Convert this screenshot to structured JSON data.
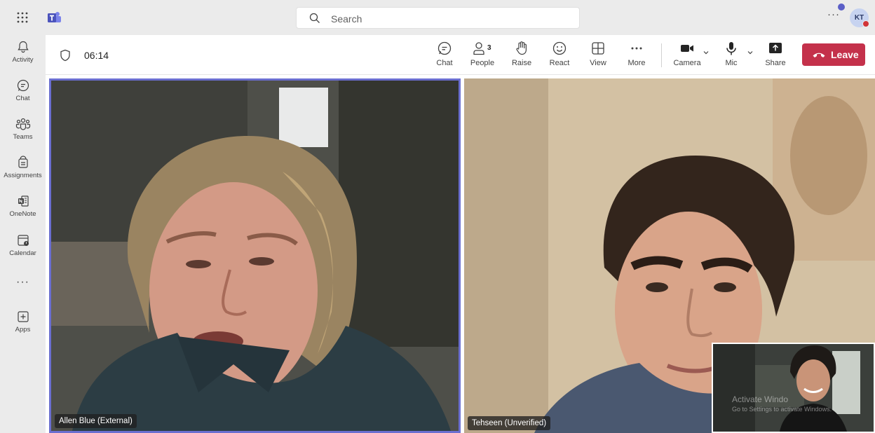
{
  "topbar": {
    "search_placeholder": "Search",
    "avatar_initials": "KT",
    "more_label": "···"
  },
  "rail": {
    "items": [
      {
        "label": "Activity",
        "icon": "bell-icon"
      },
      {
        "label": "Chat",
        "icon": "chat-icon"
      },
      {
        "label": "Teams",
        "icon": "teams-icon"
      },
      {
        "label": "Assignments",
        "icon": "assignments-icon"
      },
      {
        "label": "OneNote",
        "icon": "onenote-icon"
      },
      {
        "label": "Calendar",
        "icon": "calendar-icon"
      },
      {
        "label": "Apps",
        "icon": "apps-plus-icon"
      }
    ],
    "more_label": "···"
  },
  "meeting": {
    "timer": "06:14",
    "controls": [
      {
        "label": "Chat",
        "icon": "chat-icon"
      },
      {
        "label": "People",
        "icon": "people-icon",
        "count": "3"
      },
      {
        "label": "Raise",
        "icon": "raise-hand-icon"
      },
      {
        "label": "React",
        "icon": "smiley-icon"
      },
      {
        "label": "View",
        "icon": "grid-icon"
      },
      {
        "label": "More",
        "icon": "more-icon"
      },
      {
        "label": "Camera",
        "icon": "camera-icon"
      },
      {
        "label": "Mic",
        "icon": "mic-icon"
      },
      {
        "label": "Share",
        "icon": "share-icon"
      }
    ],
    "leave_label": "Leave",
    "leave_color": "#c4314b"
  },
  "participants": [
    {
      "name": "Allen Blue (External)"
    },
    {
      "name": "Tehseen (Unverified)"
    }
  ],
  "self_view": {
    "watermark_title": "Activate Windo",
    "watermark_sub": "Go to Settings to activate Windows."
  },
  "colors": {
    "accent": "#5b5fc7",
    "active_tile_border": "#6b6fd0"
  }
}
